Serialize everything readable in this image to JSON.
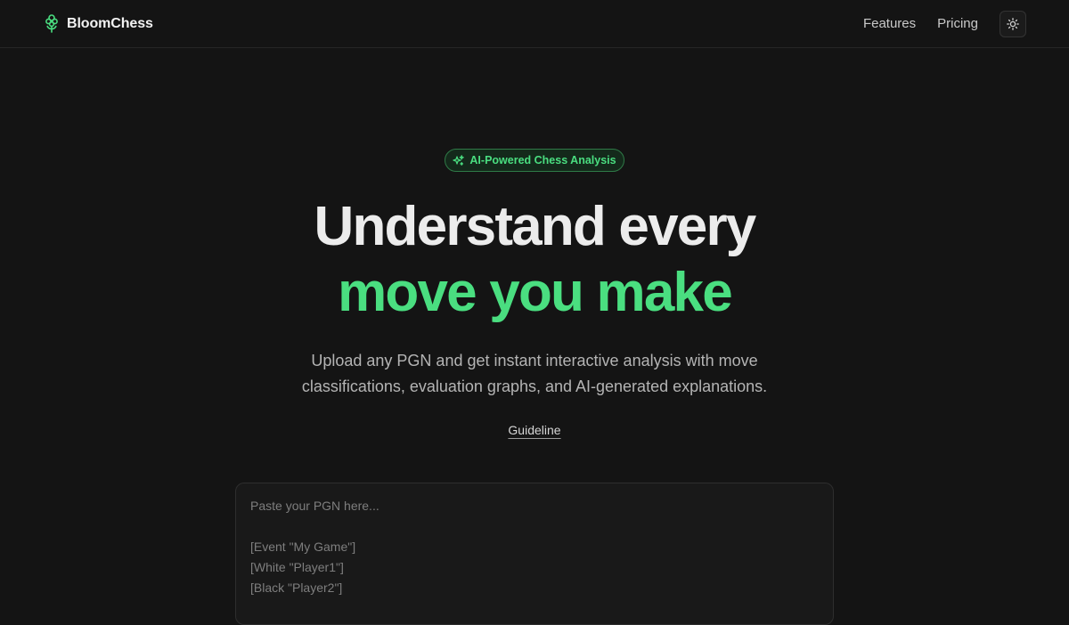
{
  "brand": {
    "name": "BloomChess",
    "icon": "flower-icon",
    "color": "#4ade80"
  },
  "nav": {
    "links": [
      "Features",
      "Pricing"
    ],
    "theme_toggle_icon": "sun-icon"
  },
  "hero": {
    "badge": {
      "icon": "sparkles-icon",
      "text": "AI-Powered Chess Analysis"
    },
    "title_line1": "Understand every",
    "title_line2": "move you make",
    "subtitle_line1": "Upload any PGN and get instant interactive analysis with move",
    "subtitle_line2": "classifications, evaluation graphs, and AI-generated explanations.",
    "guideline_link": "Guideline"
  },
  "pgn_input": {
    "placeholder_lines": [
      "Paste your PGN here...",
      "",
      "[Event \"My Game\"]",
      "[White \"Player1\"]",
      "[Black \"Player2\"]"
    ]
  },
  "colors": {
    "background": "#141414",
    "accent": "#4ade80",
    "text": "#ececec",
    "muted": "#b4b4b4"
  }
}
